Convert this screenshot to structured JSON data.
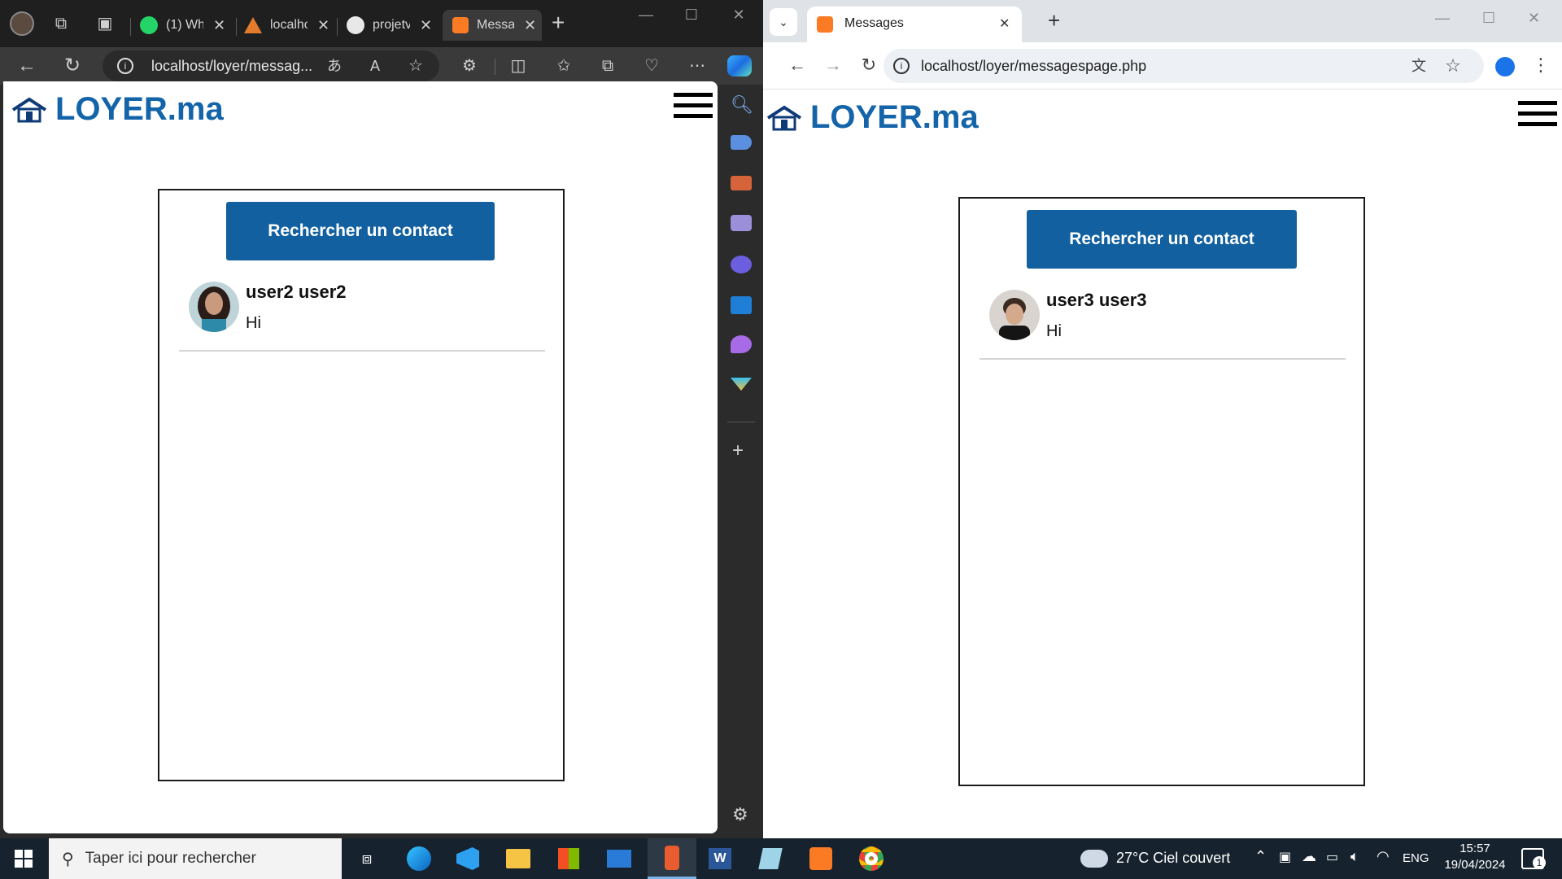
{
  "edge": {
    "tabs": [
      {
        "title": "(1) Wh"
      },
      {
        "title": "localhc"
      },
      {
        "title": "projetv"
      },
      {
        "title": "Messa"
      }
    ],
    "url": "localhost/loyer/messag..."
  },
  "chrome": {
    "tab_title": "Messages",
    "url": "localhost/loyer/messagespage.php"
  },
  "site": {
    "logo_text": "LOYER.ma",
    "search_button": "Rechercher un contact"
  },
  "left_page": {
    "contacts": [
      {
        "name": "user2 user2",
        "last_message": "Hi"
      }
    ]
  },
  "right_page": {
    "contacts": [
      {
        "name": "user3 user3",
        "last_message": "Hi"
      }
    ]
  },
  "taskbar": {
    "search_placeholder": "Taper ici pour rechercher",
    "weather": "27°C  Ciel couvert",
    "language": "ENG",
    "time": "15:57",
    "date": "19/04/2024",
    "notification_count": "1"
  },
  "colors": {
    "brand_blue": "#1464aa",
    "button_blue": "#1260a0",
    "edge_dark": "#2b2b2b",
    "chrome_tabbar": "#dfe3e8",
    "taskbar": "#16232e"
  }
}
